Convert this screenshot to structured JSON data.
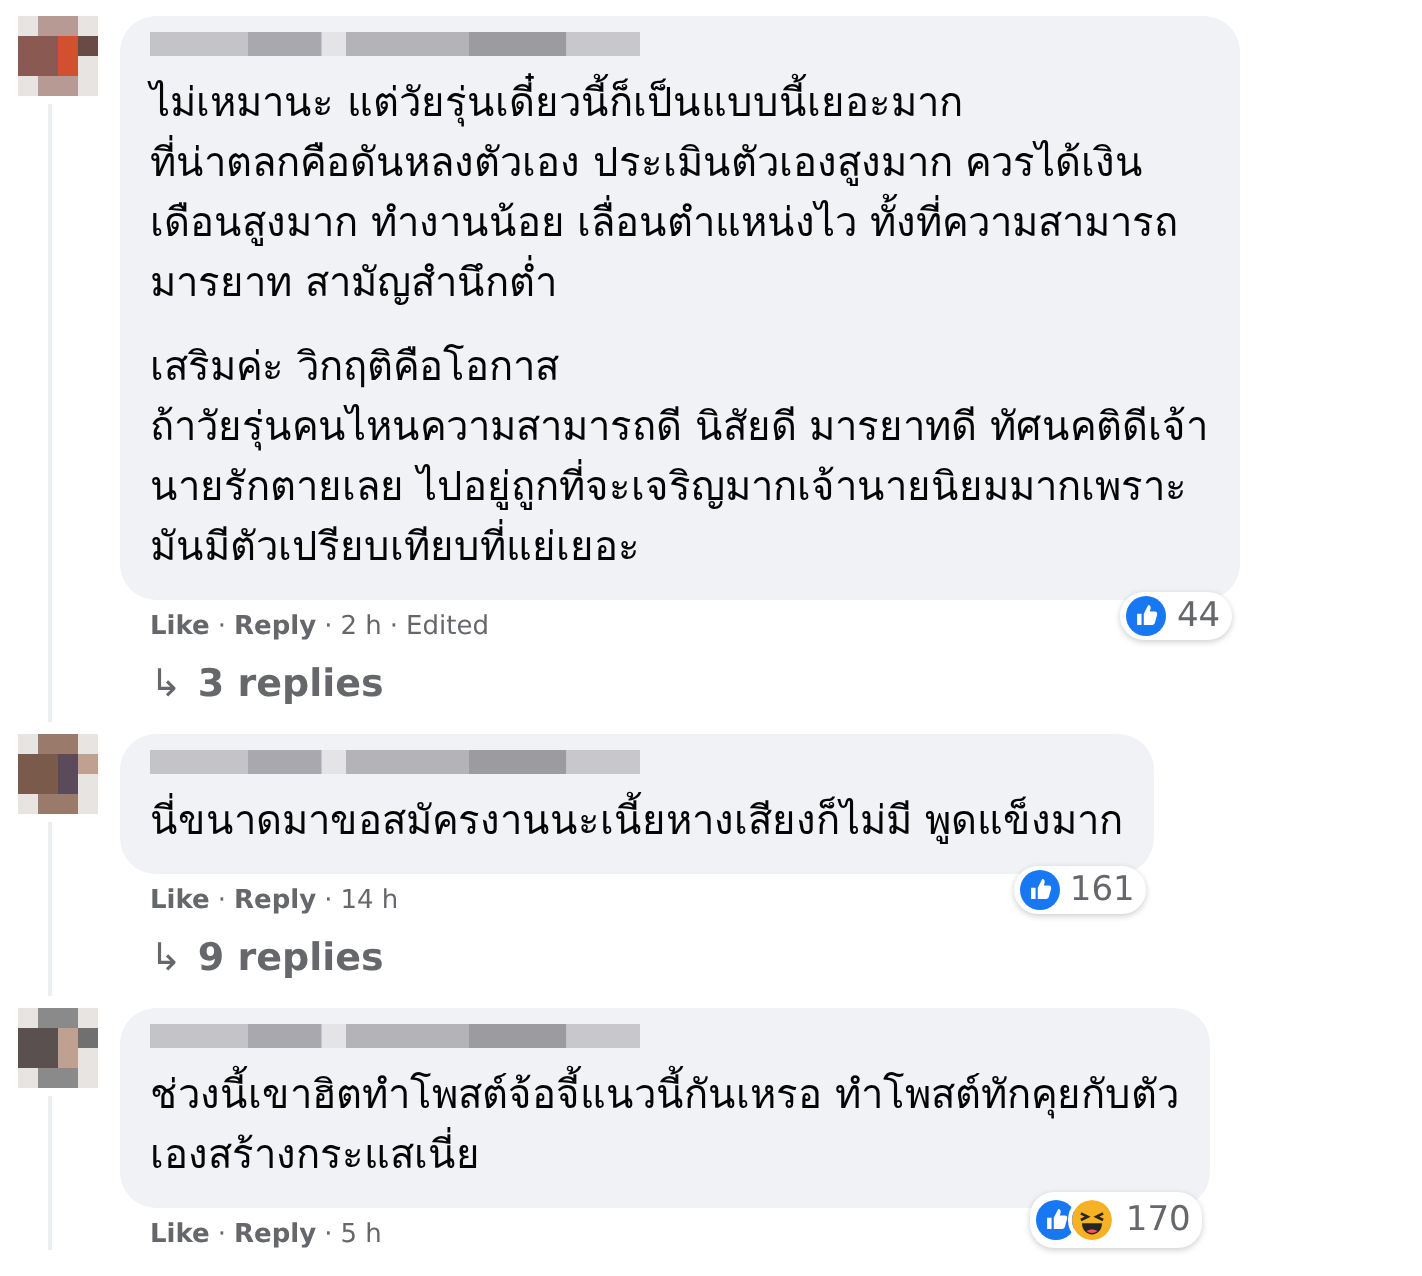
{
  "separator": "·",
  "comments": [
    {
      "avatar": {
        "kind": "picture"
      },
      "paragraphs": [
        "ไม่เหมานะ แต่วัยรุ่นเดี๋ยวนี้ก็เป็นแบบนี้เยอะมาก\nที่น่าตลกคือดันหลงตัวเอง ประเมินตัวเองสูงมาก ควรได้เงิน\nเดือนสูงมาก ทำงานน้อย เลื่อนตำแหน่งไว ทั้งที่ความสามารถ\nมารยาท สามัญสำนึกต่ำ",
        "เสริมค่ะ วิกฤติคือโอกาส\nถ้าวัยรุ่นคนไหนความสามารถดี นิสัยดี มารยาทดี ทัศนคติดีเจ้า\nนายรักตายเลย ไปอยู่ถูกที่จะเจริญมากเจ้านายนิยมมากเพราะ\nมันมีตัวเปรียบเทียบที่แย่เยอะ"
      ],
      "reactions": [
        {
          "kind": "like"
        }
      ],
      "reaction_count": "44",
      "like": "Like",
      "reply": "Reply",
      "time": "2 h",
      "edited": "Edited",
      "replies_arrow": "↳",
      "replies": "3 replies"
    },
    {
      "avatar": {
        "kind": "picture"
      },
      "paragraphs": [
        "นี่ขนาดมาขอสมัครงานนะเนี้ยหางเสียงก็ไม่มี พูดแข็งมาก"
      ],
      "reactions": [
        {
          "kind": "like"
        }
      ],
      "reaction_count": "161",
      "like": "Like",
      "reply": "Reply",
      "time": "14 h",
      "replies_arrow": "↳",
      "replies": "9 replies"
    },
    {
      "avatar": {
        "kind": "picture"
      },
      "paragraphs": [
        "ช่วงนี้เขาฮิตทำโพสต์จ้อจี้แนวนี้กันเหรอ ทำโพสต์ทักคุยกับตัว\nเองสร้างกระแสเนี่ย"
      ],
      "reactions": [
        {
          "kind": "like"
        },
        {
          "kind": "haha"
        }
      ],
      "reaction_count": "170",
      "like": "Like",
      "reply": "Reply",
      "time": "5 h"
    }
  ]
}
